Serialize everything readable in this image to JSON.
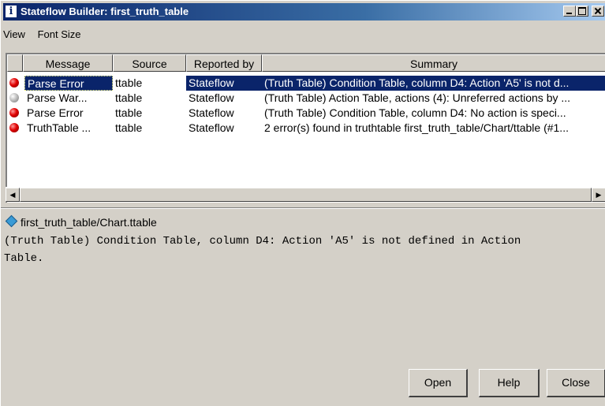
{
  "window": {
    "title": "Stateflow Builder: first_truth_table",
    "icon": "info-icon"
  },
  "menu": [
    "View",
    "Font Size"
  ],
  "table": {
    "columns": [
      "Message",
      "Source",
      "Reported by",
      "Summary"
    ],
    "rows": [
      {
        "type": "error",
        "message": "Parse Error",
        "source": "ttable",
        "reported_by": "Stateflow",
        "summary": "(Truth Table) Condition Table, column D4: Action 'A5' is not d...",
        "selected": true
      },
      {
        "type": "warning",
        "message": "Parse War...",
        "source": "ttable",
        "reported_by": "Stateflow",
        "summary": "(Truth Table) Action Table, actions (4): Unreferred actions by ..."
      },
      {
        "type": "error",
        "message": "Parse Error",
        "source": "ttable",
        "reported_by": "Stateflow",
        "summary": "(Truth Table) Condition Table, column D4: No action is speci..."
      },
      {
        "type": "error",
        "message": "TruthTable ...",
        "source": "ttable",
        "reported_by": "Stateflow",
        "summary": "2 error(s) found in truthtable first_truth_table/Chart/ttable (#1..."
      }
    ]
  },
  "scroll": {
    "left_arrow": "◀",
    "right_arrow": "▶"
  },
  "detail": {
    "path": "first_truth_table/Chart.ttable",
    "text": "(Truth Table) Condition Table, column D4: Action 'A5' is not defined in Action\nTable."
  },
  "buttons": {
    "open": "Open",
    "help": "Help",
    "close": "Close"
  },
  "colors": {
    "title_bar": "#0a246a",
    "selection": "#0a246a",
    "face": "#d4d0c8",
    "error": "#e00000"
  }
}
